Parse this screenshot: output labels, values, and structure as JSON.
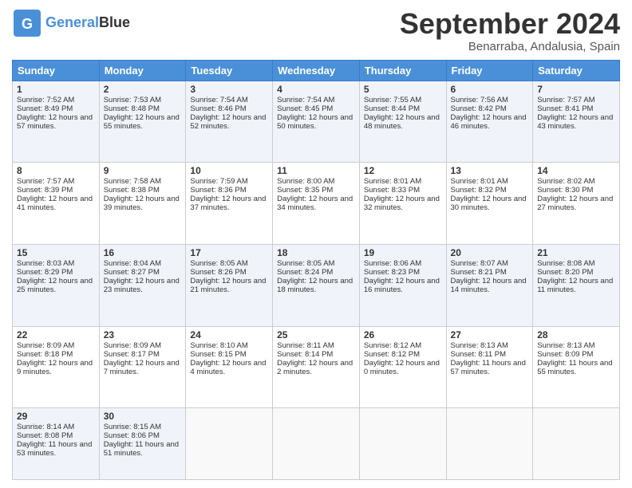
{
  "logo": {
    "general": "General",
    "blue": "Blue"
  },
  "header": {
    "month": "September 2024",
    "location": "Benarraba, Andalusia, Spain"
  },
  "weekdays": [
    "Sunday",
    "Monday",
    "Tuesday",
    "Wednesday",
    "Thursday",
    "Friday",
    "Saturday"
  ],
  "weeks": [
    [
      {
        "day": 1,
        "sunrise": "7:52 AM",
        "sunset": "8:49 PM",
        "daylight": "12 hours and 57 minutes."
      },
      {
        "day": 2,
        "sunrise": "7:53 AM",
        "sunset": "8:48 PM",
        "daylight": "12 hours and 55 minutes."
      },
      {
        "day": 3,
        "sunrise": "7:54 AM",
        "sunset": "8:46 PM",
        "daylight": "12 hours and 52 minutes."
      },
      {
        "day": 4,
        "sunrise": "7:54 AM",
        "sunset": "8:45 PM",
        "daylight": "12 hours and 50 minutes."
      },
      {
        "day": 5,
        "sunrise": "7:55 AM",
        "sunset": "8:44 PM",
        "daylight": "12 hours and 48 minutes."
      },
      {
        "day": 6,
        "sunrise": "7:56 AM",
        "sunset": "8:42 PM",
        "daylight": "12 hours and 46 minutes."
      },
      {
        "day": 7,
        "sunrise": "7:57 AM",
        "sunset": "8:41 PM",
        "daylight": "12 hours and 43 minutes."
      }
    ],
    [
      {
        "day": 8,
        "sunrise": "7:57 AM",
        "sunset": "8:39 PM",
        "daylight": "12 hours and 41 minutes."
      },
      {
        "day": 9,
        "sunrise": "7:58 AM",
        "sunset": "8:38 PM",
        "daylight": "12 hours and 39 minutes."
      },
      {
        "day": 10,
        "sunrise": "7:59 AM",
        "sunset": "8:36 PM",
        "daylight": "12 hours and 37 minutes."
      },
      {
        "day": 11,
        "sunrise": "8:00 AM",
        "sunset": "8:35 PM",
        "daylight": "12 hours and 34 minutes."
      },
      {
        "day": 12,
        "sunrise": "8:01 AM",
        "sunset": "8:33 PM",
        "daylight": "12 hours and 32 minutes."
      },
      {
        "day": 13,
        "sunrise": "8:01 AM",
        "sunset": "8:32 PM",
        "daylight": "12 hours and 30 minutes."
      },
      {
        "day": 14,
        "sunrise": "8:02 AM",
        "sunset": "8:30 PM",
        "daylight": "12 hours and 27 minutes."
      }
    ],
    [
      {
        "day": 15,
        "sunrise": "8:03 AM",
        "sunset": "8:29 PM",
        "daylight": "12 hours and 25 minutes."
      },
      {
        "day": 16,
        "sunrise": "8:04 AM",
        "sunset": "8:27 PM",
        "daylight": "12 hours and 23 minutes."
      },
      {
        "day": 17,
        "sunrise": "8:05 AM",
        "sunset": "8:26 PM",
        "daylight": "12 hours and 21 minutes."
      },
      {
        "day": 18,
        "sunrise": "8:05 AM",
        "sunset": "8:24 PM",
        "daylight": "12 hours and 18 minutes."
      },
      {
        "day": 19,
        "sunrise": "8:06 AM",
        "sunset": "8:23 PM",
        "daylight": "12 hours and 16 minutes."
      },
      {
        "day": 20,
        "sunrise": "8:07 AM",
        "sunset": "8:21 PM",
        "daylight": "12 hours and 14 minutes."
      },
      {
        "day": 21,
        "sunrise": "8:08 AM",
        "sunset": "8:20 PM",
        "daylight": "12 hours and 11 minutes."
      }
    ],
    [
      {
        "day": 22,
        "sunrise": "8:09 AM",
        "sunset": "8:18 PM",
        "daylight": "12 hours and 9 minutes."
      },
      {
        "day": 23,
        "sunrise": "8:09 AM",
        "sunset": "8:17 PM",
        "daylight": "12 hours and 7 minutes."
      },
      {
        "day": 24,
        "sunrise": "8:10 AM",
        "sunset": "8:15 PM",
        "daylight": "12 hours and 4 minutes."
      },
      {
        "day": 25,
        "sunrise": "8:11 AM",
        "sunset": "8:14 PM",
        "daylight": "12 hours and 2 minutes."
      },
      {
        "day": 26,
        "sunrise": "8:12 AM",
        "sunset": "8:12 PM",
        "daylight": "12 hours and 0 minutes."
      },
      {
        "day": 27,
        "sunrise": "8:13 AM",
        "sunset": "8:11 PM",
        "daylight": "11 hours and 57 minutes."
      },
      {
        "day": 28,
        "sunrise": "8:13 AM",
        "sunset": "8:09 PM",
        "daylight": "11 hours and 55 minutes."
      }
    ],
    [
      {
        "day": 29,
        "sunrise": "8:14 AM",
        "sunset": "8:08 PM",
        "daylight": "11 hours and 53 minutes."
      },
      {
        "day": 30,
        "sunrise": "8:15 AM",
        "sunset": "8:06 PM",
        "daylight": "11 hours and 51 minutes."
      },
      null,
      null,
      null,
      null,
      null
    ]
  ]
}
